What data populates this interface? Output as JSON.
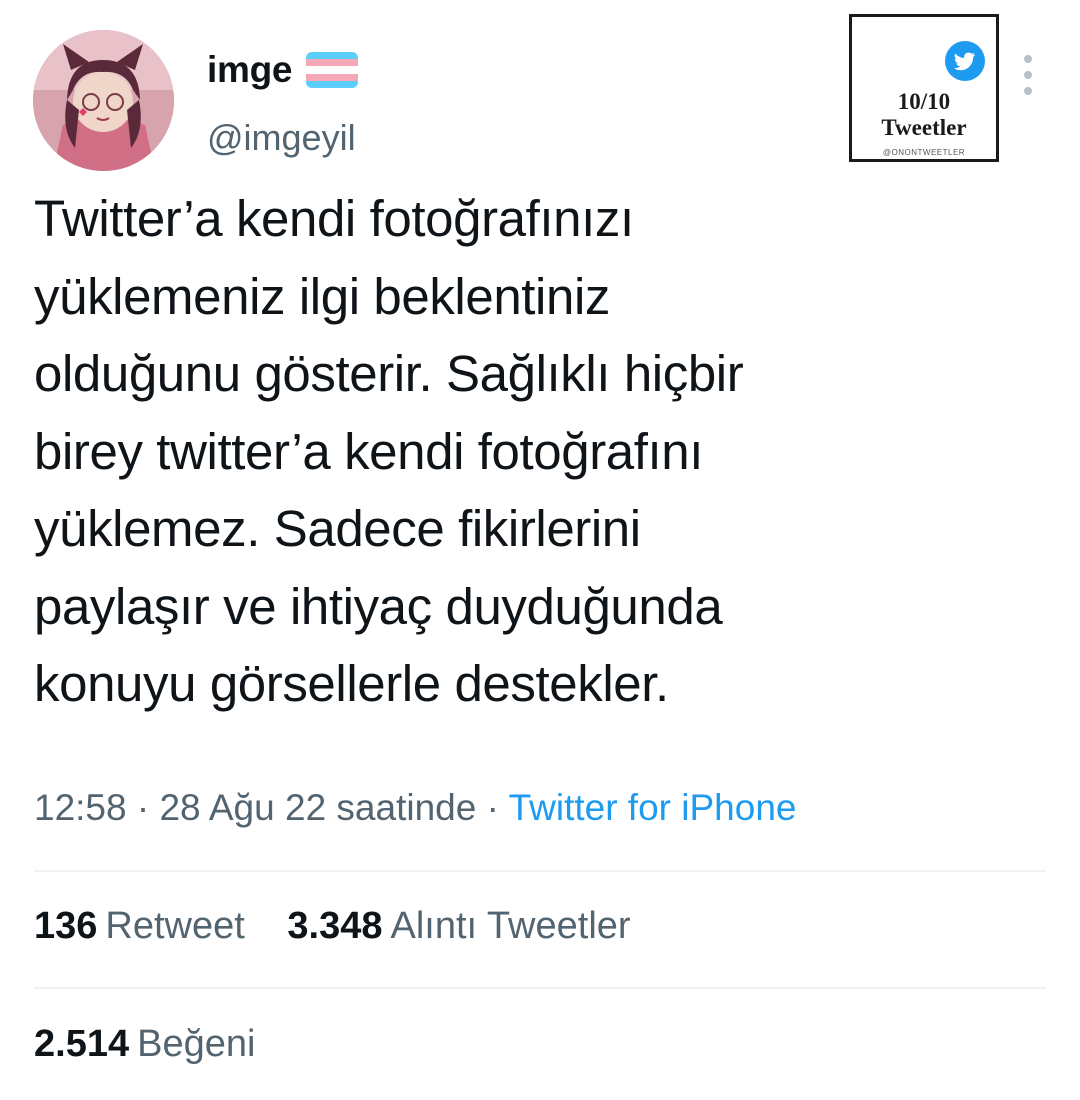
{
  "user": {
    "display_name": "imge",
    "handle": "@imgeyil",
    "flag_icon": "transgender-flag-icon",
    "flag_colors": [
      "#5bcefa",
      "#f5a9b8",
      "#ffffff",
      "#f5a9b8",
      "#5bcefa"
    ]
  },
  "watermark": {
    "icon": "twitter-bird-icon",
    "count": "10/10",
    "label": "Tweetler",
    "handle": "@ONONTWEETLER"
  },
  "tweet": {
    "text": "Twitter’a kendi fotoğrafınızı\nyüklemeniz ilgi beklentiniz\nolduğunu gösterir. Sağlıklı hiçbir\nbirey twitter’a kendi fotoğrafını\nyüklemez. Sadece fikirlerini\npaylaşır ve ihtiyaç duyduğunda\nkonuyu görsellerle destekler.",
    "time": "12:58",
    "separator": "·",
    "date": "28 Ağu 22 saatinde",
    "source": "Twitter for iPhone"
  },
  "stats": {
    "retweets_count": "136",
    "retweets_label": "Retweet",
    "quotes_count": "3.348",
    "quotes_label": "Alıntı Tweetler",
    "likes_count": "2.514",
    "likes_label": "Beğeni"
  },
  "colors": {
    "text": "#0f1419",
    "secondary": "#536471",
    "accent": "#1d9bf0",
    "divider": "#eff3f4"
  }
}
